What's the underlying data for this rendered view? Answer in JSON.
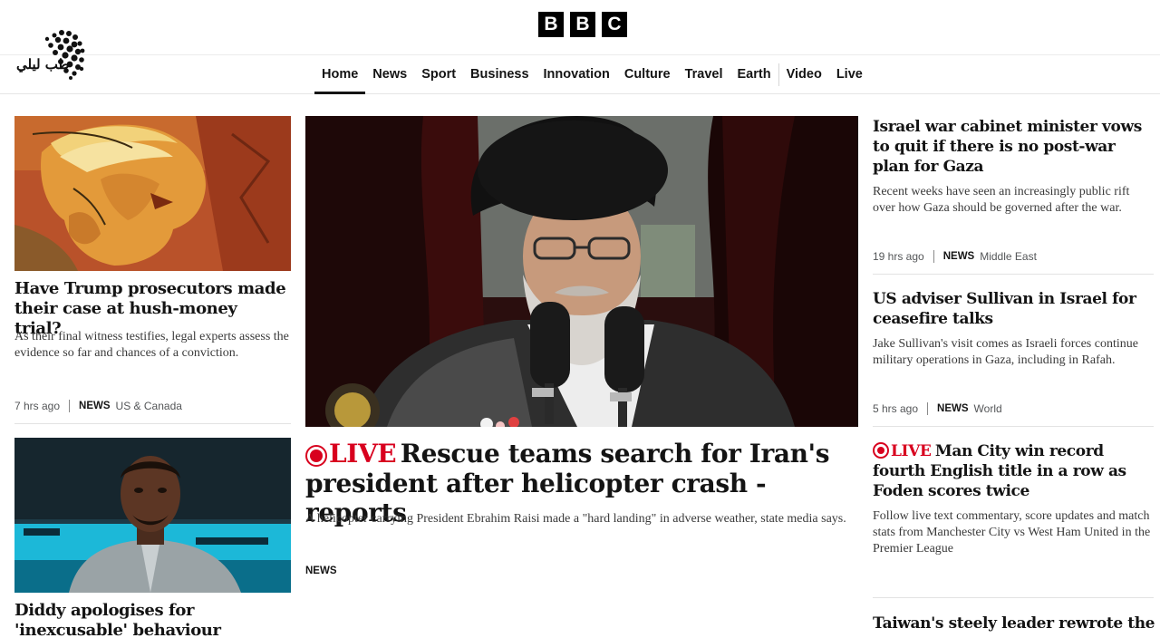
{
  "brand": {
    "letters": [
      "B",
      "B",
      "C"
    ]
  },
  "site_logo": {
    "text": "طب ليلي"
  },
  "nav": {
    "items": [
      {
        "label": "Home",
        "active": true
      },
      {
        "label": "News"
      },
      {
        "label": "Sport"
      },
      {
        "label": "Business"
      },
      {
        "label": "Innovation"
      },
      {
        "label": "Culture"
      },
      {
        "label": "Travel"
      },
      {
        "label": "Earth"
      },
      {
        "label": "Video"
      },
      {
        "label": "Live"
      }
    ]
  },
  "left": {
    "story1": {
      "headline": "Have Trump prosecutors made their case at hush-money trial?",
      "summary": "As their final witness testifies, legal experts assess the evidence so far and chances of a conviction.",
      "time": "7 hrs ago",
      "section": "NEWS",
      "topic": "US & Canada"
    },
    "story2": {
      "headline": "Diddy apologises for 'inexcusable' behaviour"
    }
  },
  "center": {
    "live_label": "LIVE",
    "headline": "Rescue teams search for Iran's president after helicopter crash - reports",
    "summary": "A helicopter carrying President Ebrahim Raisi made a \"hard landing\" in adverse weather, state media says.",
    "section": "NEWS"
  },
  "right": {
    "story1": {
      "headline": "Israel war cabinet minister vows to quit if there is no post-war plan for Gaza",
      "summary": "Recent weeks have seen an increasingly public rift over how Gaza should be governed after the war.",
      "time": "19 hrs ago",
      "section": "NEWS",
      "topic": "Middle East"
    },
    "story2": {
      "headline": "US adviser Sullivan in Israel for ceasefire talks",
      "summary": "Jake Sullivan's visit comes as Israeli forces continue military operations in Gaza, including in Rafah.",
      "time": "5 hrs ago",
      "section": "NEWS",
      "topic": "World"
    },
    "story3": {
      "live_label": "LIVE",
      "headline": "Man City win record fourth English title in a row as Foden scores twice",
      "summary": "Follow live text commentary, score updates and match stats from Manchester City vs West Ham United in the Premier League"
    },
    "story4": {
      "headline": "Taiwan's steely leader rewrote the"
    }
  },
  "colors": {
    "live_red": "#d8001e",
    "text": "#141414"
  }
}
